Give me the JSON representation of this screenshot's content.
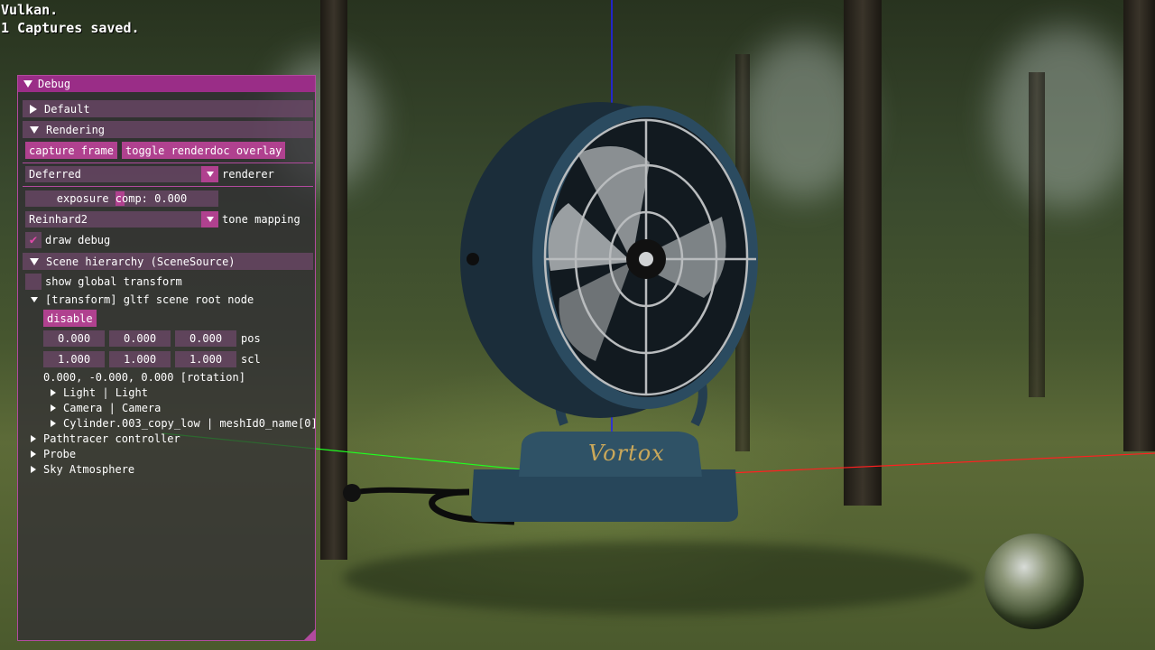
{
  "overlay": {
    "line1": "Vulkan.",
    "line2": "1 Captures saved."
  },
  "debug": {
    "title": "Debug",
    "sections": {
      "default_label": "Default",
      "rendering_label": "Rendering",
      "scene_hierarchy_label": "Scene hierarchy (SceneSource)"
    },
    "buttons": {
      "capture_frame": "capture frame",
      "toggle_renderdoc": "toggle renderdoc overlay",
      "disable": "disable"
    },
    "renderer": {
      "value": "Deferred",
      "label": "renderer"
    },
    "exposure": {
      "text": "exposure comp: 0.000"
    },
    "tone_mapping": {
      "value": "Reinhard2",
      "label": "tone mapping"
    },
    "draw_debug": {
      "label": "draw debug",
      "checked": true
    },
    "show_global_transform": {
      "label": "show global transform",
      "checked": false
    },
    "root_node": {
      "label": "[transform] gltf scene root node",
      "pos": [
        "0.000",
        "0.000",
        "0.000"
      ],
      "pos_label": "pos",
      "scl": [
        "1.000",
        "1.000",
        "1.000"
      ],
      "scl_label": "scl",
      "rotation": "0.000, -0.000, 0.000 [rotation]",
      "children": [
        "Light | Light",
        "Camera | Camera",
        "Cylinder.003_copy_low | meshId0_name[0]"
      ]
    },
    "other_nodes": [
      "Pathtracer controller",
      "Probe",
      "Sky Atmosphere"
    ]
  },
  "scene": {
    "fan_logo_text": "Vortox"
  }
}
